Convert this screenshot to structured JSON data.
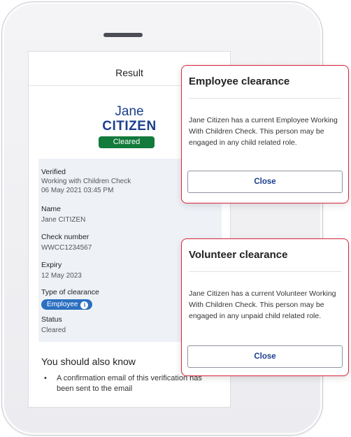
{
  "screen": {
    "title": "Result",
    "first_name": "Jane",
    "last_name": "CITIZEN",
    "status_badge": "Cleared",
    "details": {
      "verified_label": "Verified",
      "verified_value_line1": "Working with Children Check",
      "verified_value_line2": "06 May 2021 03:45 PM",
      "name_label": "Name",
      "name_value": "Jane CITIZEN",
      "check_label": "Check number",
      "check_value": "WWCC1234567",
      "expiry_label": "Expiry",
      "expiry_value": "12 May 2023",
      "type_label": "Type of clearance",
      "type_value": "Employee",
      "status_label": "Status",
      "status_value": "Cleared"
    },
    "also_know_heading": "You should also know",
    "bullets": [
      "A confirmation email of this verification has been sent to the email"
    ]
  },
  "employee_popup": {
    "title": "Employee clearance",
    "body": "Jane Citizen has a current Employee Working With Children Check.  This person may be engaged in any child related role.",
    "close_label": "Close"
  },
  "volunteer_popup": {
    "title": "Volunteer clearance",
    "body": "Jane Citizen has a current Volunteer Working With Children Check. This person may be engaged in any unpaid child related role.",
    "close_label": "Close"
  },
  "colors": {
    "brand_blue": "#1b3f8f",
    "cleared_green": "#127a3a",
    "badge_blue": "#2c6fc1",
    "popup_border_red": "#d8243c"
  },
  "icons": {
    "info": "info-icon"
  }
}
